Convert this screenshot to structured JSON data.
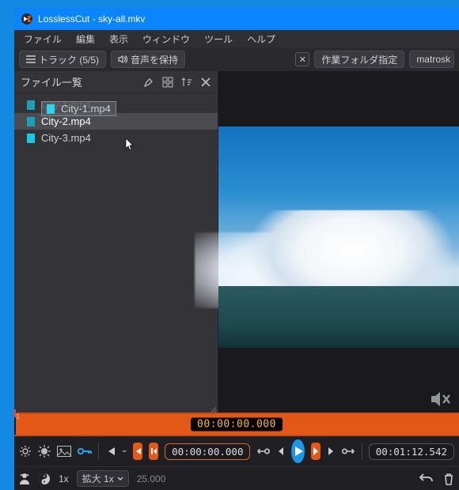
{
  "title": "LosslessCut - sky-all.mkv",
  "menu": [
    "ファイル",
    "編集",
    "表示",
    "ウィンドウ",
    "ツール",
    "ヘルプ"
  ],
  "toolbar": {
    "tracks_label": "トラック (5/5)",
    "keep_audio_label": "音声を保持",
    "work_folder_label": "作業フォルダ指定",
    "format_label": "matrosk"
  },
  "sidebar": {
    "title": "ファイル一覧",
    "files": [
      {
        "name": "City-1.mp4",
        "dim": true
      },
      {
        "name": "City-2.mp4",
        "dim": true
      },
      {
        "name": "City-3.mp4",
        "dim": false
      }
    ],
    "drag_item": "City-1.mp4"
  },
  "timeline": {
    "current": "00:00:00.000",
    "seg_index": "1"
  },
  "controls": {
    "current_time": "00:00:00.000",
    "end_time": "00:01:12.542",
    "minus": "-"
  },
  "zoom": {
    "value": "1x",
    "select_label": "拡大 1x",
    "fps": "25.000"
  }
}
